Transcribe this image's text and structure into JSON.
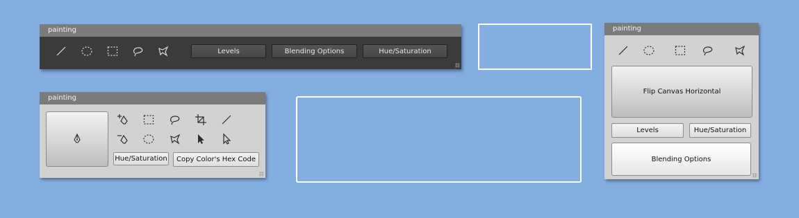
{
  "panel_top": {
    "title": "painting",
    "tools": [
      "line-tool-icon",
      "ellipse-select-icon",
      "rect-select-icon",
      "lasso-icon",
      "polygon-lasso-icon"
    ],
    "buttons": [
      "Levels",
      "Blending Options",
      "Hue/Saturation"
    ]
  },
  "panel_bottom": {
    "title": "painting",
    "buttons": [
      "Hue/Saturation",
      "Copy Color's Hex Code"
    ]
  },
  "panel_right": {
    "title": "painting",
    "flip": "Flip Canvas Horizontal",
    "levels": "Levels",
    "hue": "Hue/Saturation",
    "blending": "Blending Options"
  },
  "colors": {
    "background": "#84aee0",
    "panel_dark": "#3b3b3b",
    "panel_light": "#d2d2d2",
    "titlebar": "#7b7b7b"
  }
}
